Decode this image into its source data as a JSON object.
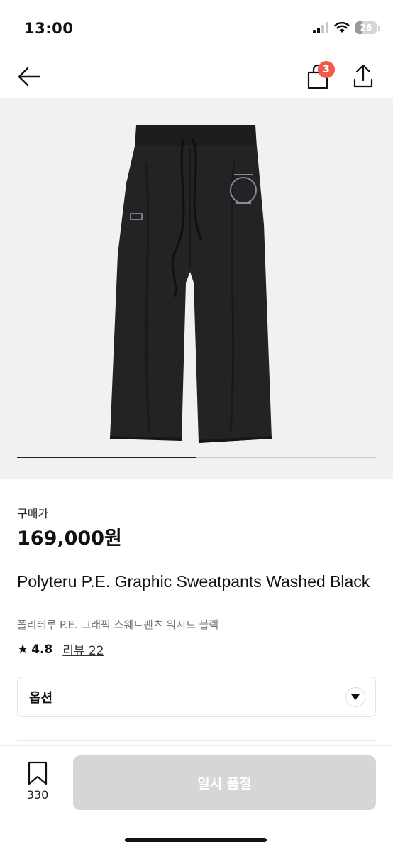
{
  "status_bar": {
    "time": "13:00",
    "battery": "26"
  },
  "nav": {
    "cart_count": "3"
  },
  "carousel": {
    "progress": 0.5
  },
  "product": {
    "price_label": "구매가",
    "price": "169,000원",
    "title": "Polyteru P.E. Graphic Sweatpants Washed Black",
    "subtitle": "폴리테루 P.E. 그래픽 스웨트팬츠 워시드 블랙",
    "rating": "4.8",
    "review_label": "리뷰 22",
    "option_label": "옵션"
  },
  "bottom_bar": {
    "bookmark_count": "330",
    "soldout_label": "일시 품절"
  },
  "colors": {
    "badge": "#ef5a4a",
    "disabled_button": "#d6d6d6",
    "image_bg": "#f1f1f1"
  }
}
